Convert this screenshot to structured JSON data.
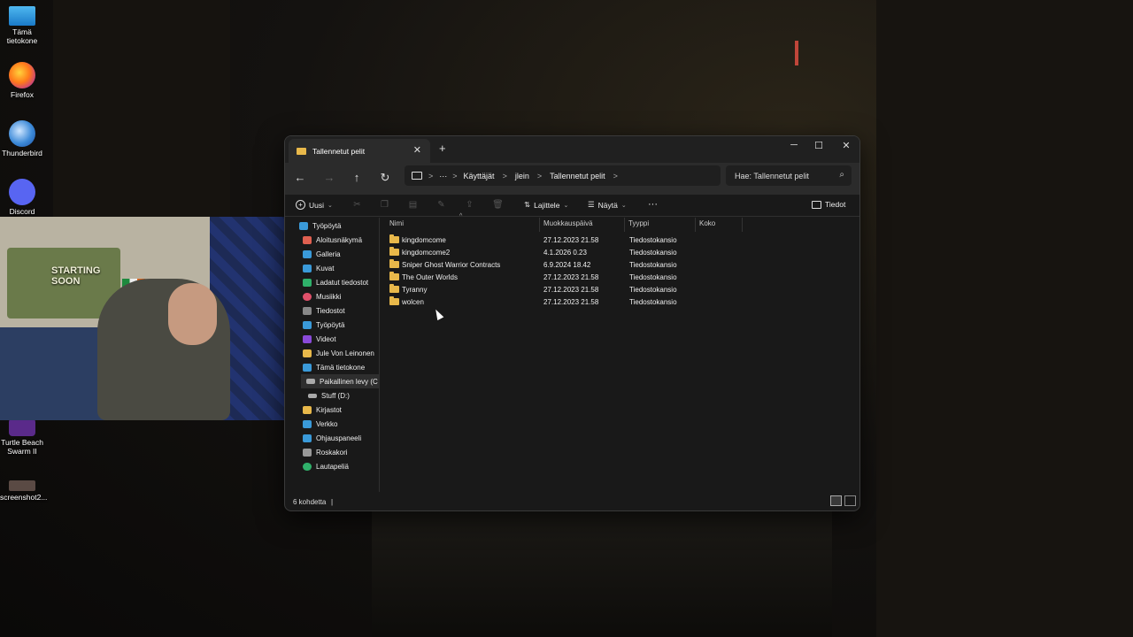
{
  "desktop": {
    "icons": [
      {
        "label": "Tämä tietokone",
        "icon": "computer-icon"
      },
      {
        "label": "Firefox",
        "icon": "firefox-icon"
      },
      {
        "label": "Thunderbird",
        "icon": "thunderbird-icon"
      },
      {
        "label": "Discord",
        "icon": "discord-icon"
      },
      {
        "label": "Turtle Beach Swarm II",
        "icon": "turtle-beach-icon"
      },
      {
        "label": "screenshot2...",
        "icon": "image-file-icon"
      }
    ]
  },
  "webcam": {
    "poster_text": "STARTING SOON"
  },
  "window": {
    "tab_title": "Tallennetut pelit",
    "new_tab": "+",
    "close_tab": "✕",
    "min": "─",
    "max": "☐",
    "close": "✕"
  },
  "address": {
    "more": "···",
    "crumbs": [
      "Käyttäjät",
      "jlein",
      "Tallennetut pelit"
    ],
    "separator": ">",
    "search_placeholder": "Hae: Tallennetut pelit"
  },
  "toolbar": {
    "new_label": "Uusi",
    "sort_label": "Lajittele",
    "view_label": "Näytä",
    "more": "···",
    "details_label": "Tiedot"
  },
  "nav": {
    "items": [
      {
        "label": "Työpöytä",
        "color": "#3a9ad9"
      },
      {
        "label": "Aloitusnäkymä",
        "color": "#e06050"
      },
      {
        "label": "Galleria",
        "color": "#3a9ad9"
      },
      {
        "label": "Kuvat",
        "color": "#3a9ad9"
      },
      {
        "label": "Ladatut tiedostot",
        "color": "#2fb06a"
      },
      {
        "label": "Musiikki",
        "color": "#e0506a"
      },
      {
        "label": "Tiedostot",
        "color": "#888"
      },
      {
        "label": "Työpöytä",
        "color": "#3a9ad9"
      },
      {
        "label": "Videot",
        "color": "#8a4ad9"
      },
      {
        "label": "Jule Von Leinonen",
        "color": "#e8b84a"
      },
      {
        "label": "Tämä tietokone",
        "color": "#3a9ad9"
      },
      {
        "label": "Paikallinen levy (C",
        "color": "#aaa"
      },
      {
        "label": "Stuff (D:)",
        "color": "#aaa"
      },
      {
        "label": "Kirjastot",
        "color": "#e8b84a"
      },
      {
        "label": "Verkko",
        "color": "#3a9ad9"
      },
      {
        "label": "Ohjauspaneeli",
        "color": "#3a9ad9"
      },
      {
        "label": "Roskakori",
        "color": "#999"
      },
      {
        "label": "Lautapeliä",
        "color": "#2fb06a"
      }
    ]
  },
  "columns": [
    "Nimi",
    "Muokkauspäivä",
    "Tyyppi",
    "Koko"
  ],
  "files": [
    {
      "name": "kingdomcome",
      "date": "27.12.2023 21.58",
      "type": "Tiedostokansio",
      "size": ""
    },
    {
      "name": "kingdomcome2",
      "date": "4.1.2026 0.23",
      "type": "Tiedostokansio",
      "size": ""
    },
    {
      "name": "Sniper Ghost Warrior Contracts",
      "date": "6.9.2024 18.42",
      "type": "Tiedostokansio",
      "size": ""
    },
    {
      "name": "The Outer Worlds",
      "date": "27.12.2023 21.58",
      "type": "Tiedostokansio",
      "size": ""
    },
    {
      "name": "Tyranny",
      "date": "27.12.2023 21.58",
      "type": "Tiedostokansio",
      "size": ""
    },
    {
      "name": "wolcen",
      "date": "27.12.2023 21.58",
      "type": "Tiedostokansio",
      "size": ""
    }
  ],
  "status": {
    "count": "6 kohdetta",
    "divider": "|"
  }
}
